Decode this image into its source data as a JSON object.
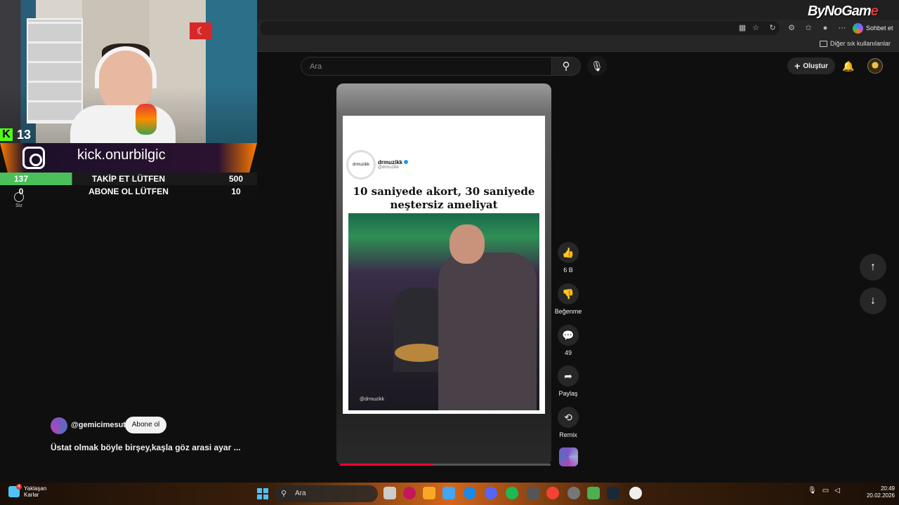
{
  "browser": {
    "copilot_label": "Sohbet et",
    "favorites_label": "Diğer sık kullanılanlar"
  },
  "watermark": {
    "brand_prefix": "ByNoGam",
    "brand_suffix": "e"
  },
  "youtube": {
    "search_placeholder": "Ara",
    "create_label": "Oluştur"
  },
  "stream_overlay": {
    "kick_count": "13",
    "kick_url": "kick.onurbilgic",
    "goals": [
      {
        "current": "137",
        "label": "TAKİP ET LÜTFEN",
        "target": "500",
        "progress": 0.274
      },
      {
        "current": "0",
        "label": "ABONE OL LÜTFEN",
        "target": "10",
        "progress": 0.0
      }
    ],
    "siz_label": "Siz"
  },
  "short": {
    "channel": "@gemicimesut",
    "subscribe_label": "Abone ol",
    "caption": "Üstat olmak böyle birşey,kaşla göz arasi ayar ...",
    "card_account_name": "drmuzikk",
    "card_account_handle": "@drmuzikk",
    "card_avatar_text": "drmuzikk",
    "card_title": "10 saniyede akort, 30 saniyede neştersiz ameliyat",
    "video_watermark": "@drmuzikk",
    "progress": 0.44
  },
  "actions": {
    "like_count": "6 B",
    "dislike_label": "Beğenme",
    "comment_count": "49",
    "share_label": "Paylaş",
    "remix_label": "Remix"
  },
  "taskbar": {
    "weather_line1": "Yaklaşan",
    "weather_line2": "Karlar",
    "weather_badge": "4",
    "search_label": "Ara",
    "time": "20:49",
    "date": "20.02.2026"
  }
}
